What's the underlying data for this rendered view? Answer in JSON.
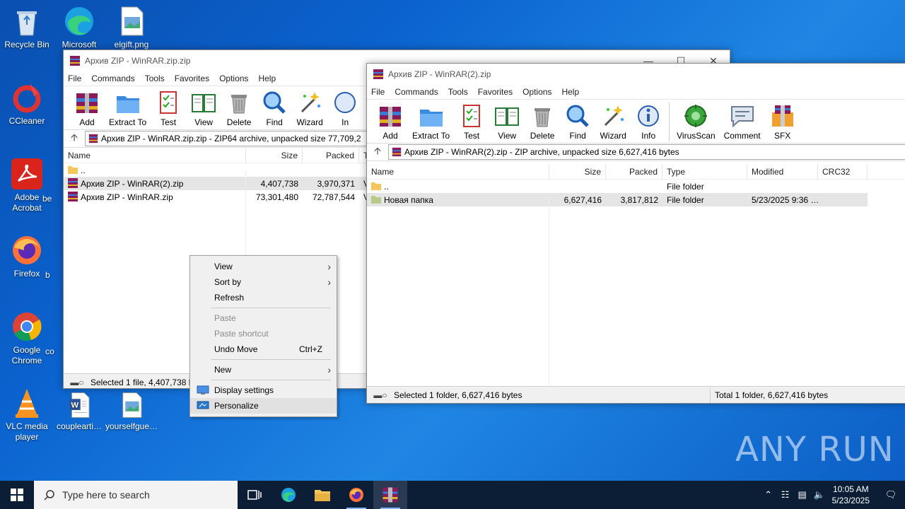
{
  "desktop": {
    "icons": [
      {
        "label": "Recycle Bin",
        "icon": "recycle-bin-icon"
      },
      {
        "label": "Microsoft",
        "icon": "edge-icon"
      },
      {
        "label": "elgift.png",
        "icon": "image-file-icon"
      },
      {
        "label": "CCleaner",
        "icon": "ccleaner-icon"
      },
      {
        "label": "Adobe Acrobat",
        "icon": "acrobat-icon"
      },
      {
        "label": "be",
        "icon": "file-icon"
      },
      {
        "label": "Firefox",
        "icon": "firefox-icon"
      },
      {
        "label": "b",
        "icon": "file-icon"
      },
      {
        "label": "Google Chrome",
        "icon": "chrome-icon"
      },
      {
        "label": "co",
        "icon": "file-icon"
      },
      {
        "label": "VLC media player",
        "icon": "vlc-icon"
      },
      {
        "label": "couplearti…",
        "icon": "word-doc-icon"
      },
      {
        "label": "yourselfgue…",
        "icon": "image-file-icon"
      }
    ]
  },
  "window1": {
    "title": "Архив ZIP - WinRAR.zip.zip",
    "menu": [
      "File",
      "Commands",
      "Tools",
      "Favorites",
      "Options",
      "Help"
    ],
    "toolbar": [
      "Add",
      "Extract To",
      "Test",
      "View",
      "Delete",
      "Find",
      "Wizard",
      "In"
    ],
    "path": "Архив ZIP - WinRAR.zip.zip - ZIP64 archive, unpacked size 77,709,2",
    "columns": [
      "Name",
      "Size",
      "Packed",
      "T"
    ],
    "rows": [
      {
        "name": "..",
        "size": "",
        "packed": "",
        "type": ""
      },
      {
        "name": "Архив ZIP - WinRAR(2).zip",
        "size": "4,407,738",
        "packed": "3,970,371",
        "type": "V"
      },
      {
        "name": "Архив ZIP - WinRAR.zip",
        "size": "73,301,480",
        "packed": "72,787,544",
        "type": "V"
      }
    ],
    "status": "Selected 1 file, 4,407,738 b"
  },
  "window2": {
    "title": "Архив ZIP - WinRAR(2).zip",
    "menu": [
      "File",
      "Commands",
      "Tools",
      "Favorites",
      "Options",
      "Help"
    ],
    "toolbar": [
      "Add",
      "Extract To",
      "Test",
      "View",
      "Delete",
      "Find",
      "Wizard",
      "Info",
      "VirusScan",
      "Comment",
      "SFX"
    ],
    "path": "Архив ZIP - WinRAR(2).zip - ZIP archive, unpacked size 6,627,416 bytes",
    "columns": [
      "Name",
      "Size",
      "Packed",
      "Type",
      "Modified",
      "CRC32"
    ],
    "rows": [
      {
        "name": "..",
        "size": "",
        "packed": "",
        "type": "File folder",
        "modified": "",
        "crc": ""
      },
      {
        "name": "Новая папка",
        "size": "6,627,416",
        "packed": "3,817,812",
        "type": "File folder",
        "modified": "5/23/2025 9:36 …",
        "crc": ""
      }
    ],
    "status_left": "Selected 1 folder, 6,627,416 bytes",
    "status_right": "Total 1 folder, 6,627,416 bytes"
  },
  "context_menu": {
    "items": [
      {
        "label": "View",
        "submenu": true
      },
      {
        "label": "Sort by",
        "submenu": true
      },
      {
        "label": "Refresh"
      },
      {
        "label": "Paste",
        "disabled": true
      },
      {
        "label": "Paste shortcut",
        "disabled": true
      },
      {
        "label": "Undo Move",
        "shortcut": "Ctrl+Z"
      },
      {
        "label": "New",
        "submenu": true
      },
      {
        "label": "Display settings"
      },
      {
        "label": "Personalize"
      }
    ]
  },
  "taskbar": {
    "search_placeholder": "Type here to search",
    "time": "10:05 AM",
    "date": "5/23/2025"
  },
  "watermark": "ANY RUN",
  "colors": {
    "accent": "#0b63cf",
    "taskbar": "#0b1e36"
  }
}
